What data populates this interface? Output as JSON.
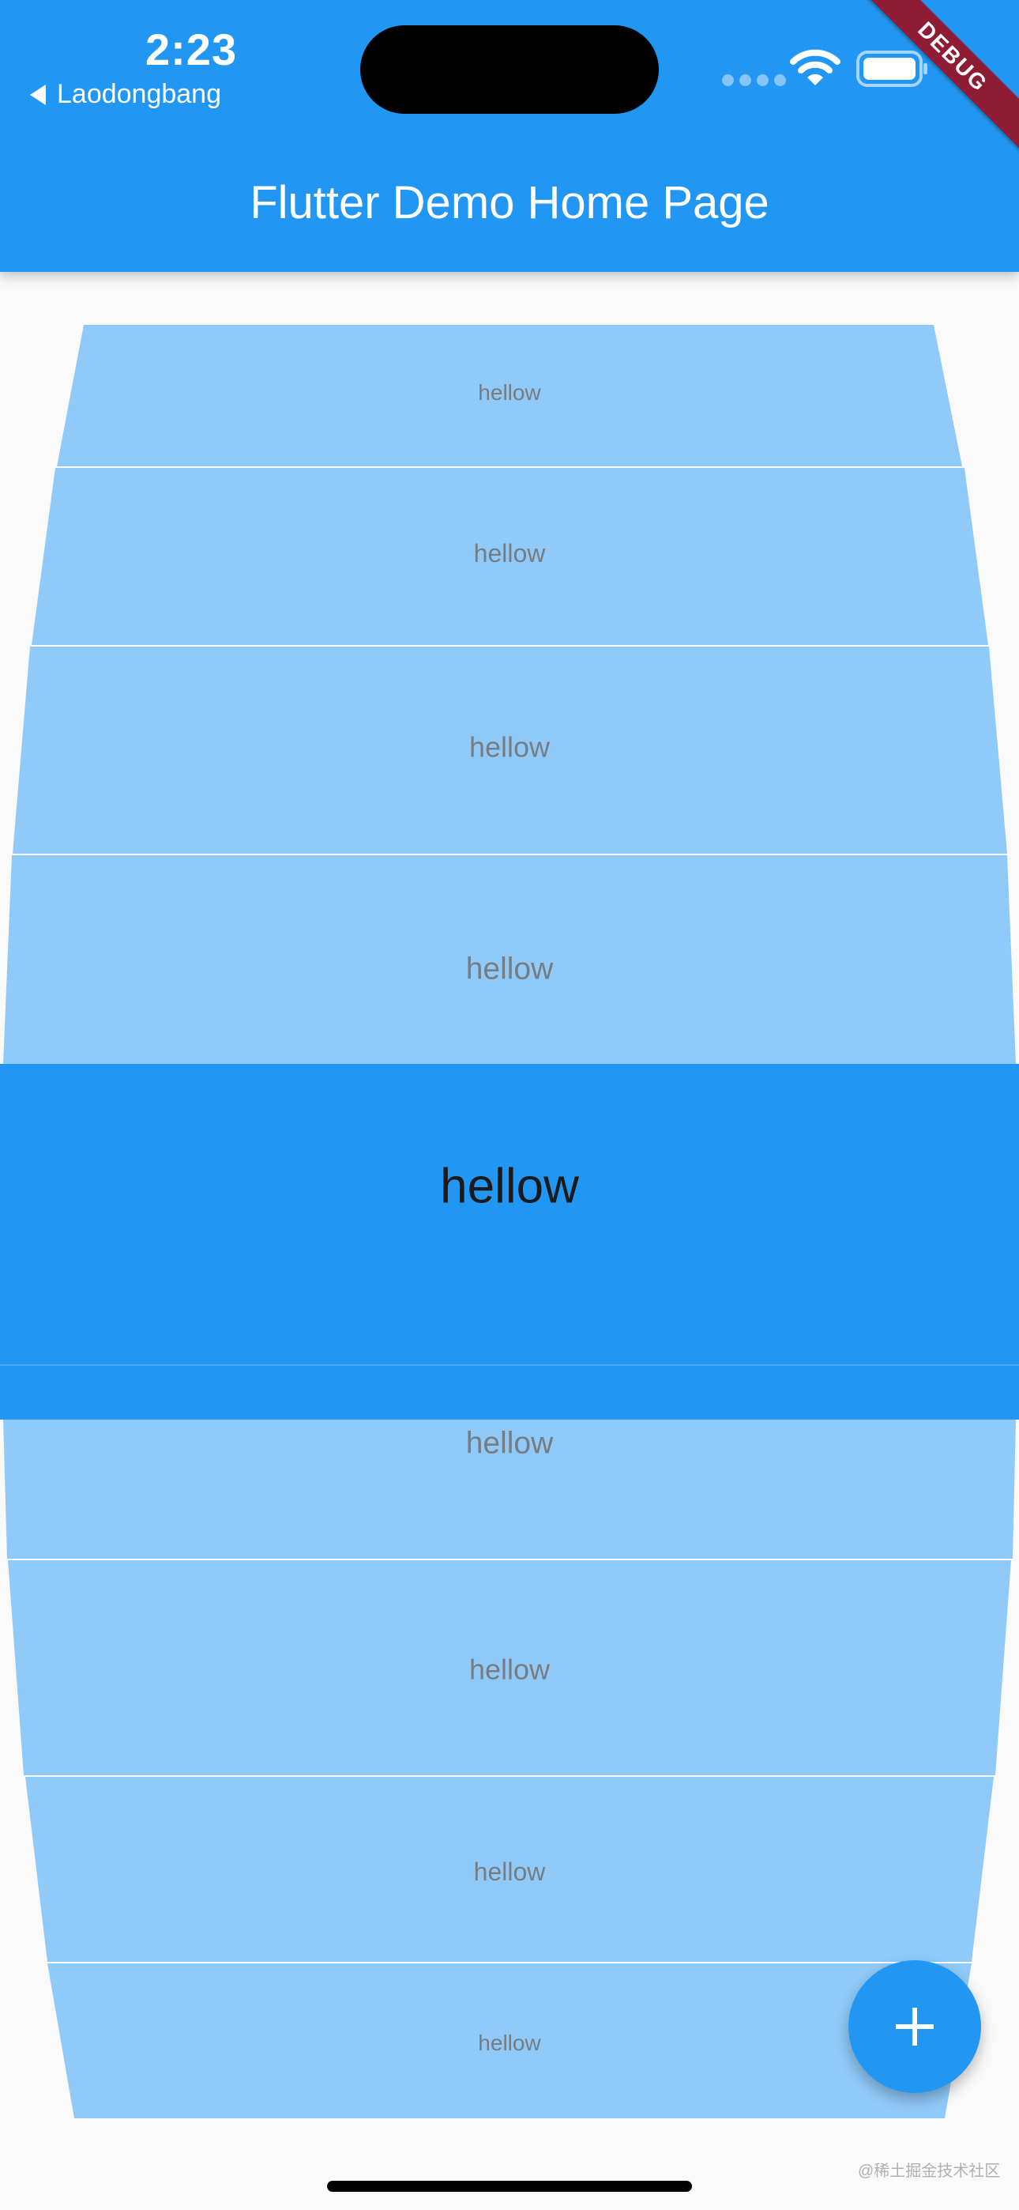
{
  "status_bar": {
    "time": "2:23",
    "back_app": "Laodongbang"
  },
  "debug_banner": "DEBUG",
  "app_bar": {
    "title": "Flutter Demo Home Page"
  },
  "wheel": {
    "items": [
      "hellow",
      "hellow",
      "hellow",
      "hellow",
      "hellow",
      "hellow",
      "hellow",
      "hellow",
      "hellow"
    ],
    "selected_index": 4
  },
  "fab": {
    "icon": "plus-icon"
  },
  "watermark": "@稀土掘金技术社区",
  "colors": {
    "primary": "#2196f3",
    "item": "#90caf9",
    "background": "#fafafa",
    "debug": "#8e1c35"
  }
}
